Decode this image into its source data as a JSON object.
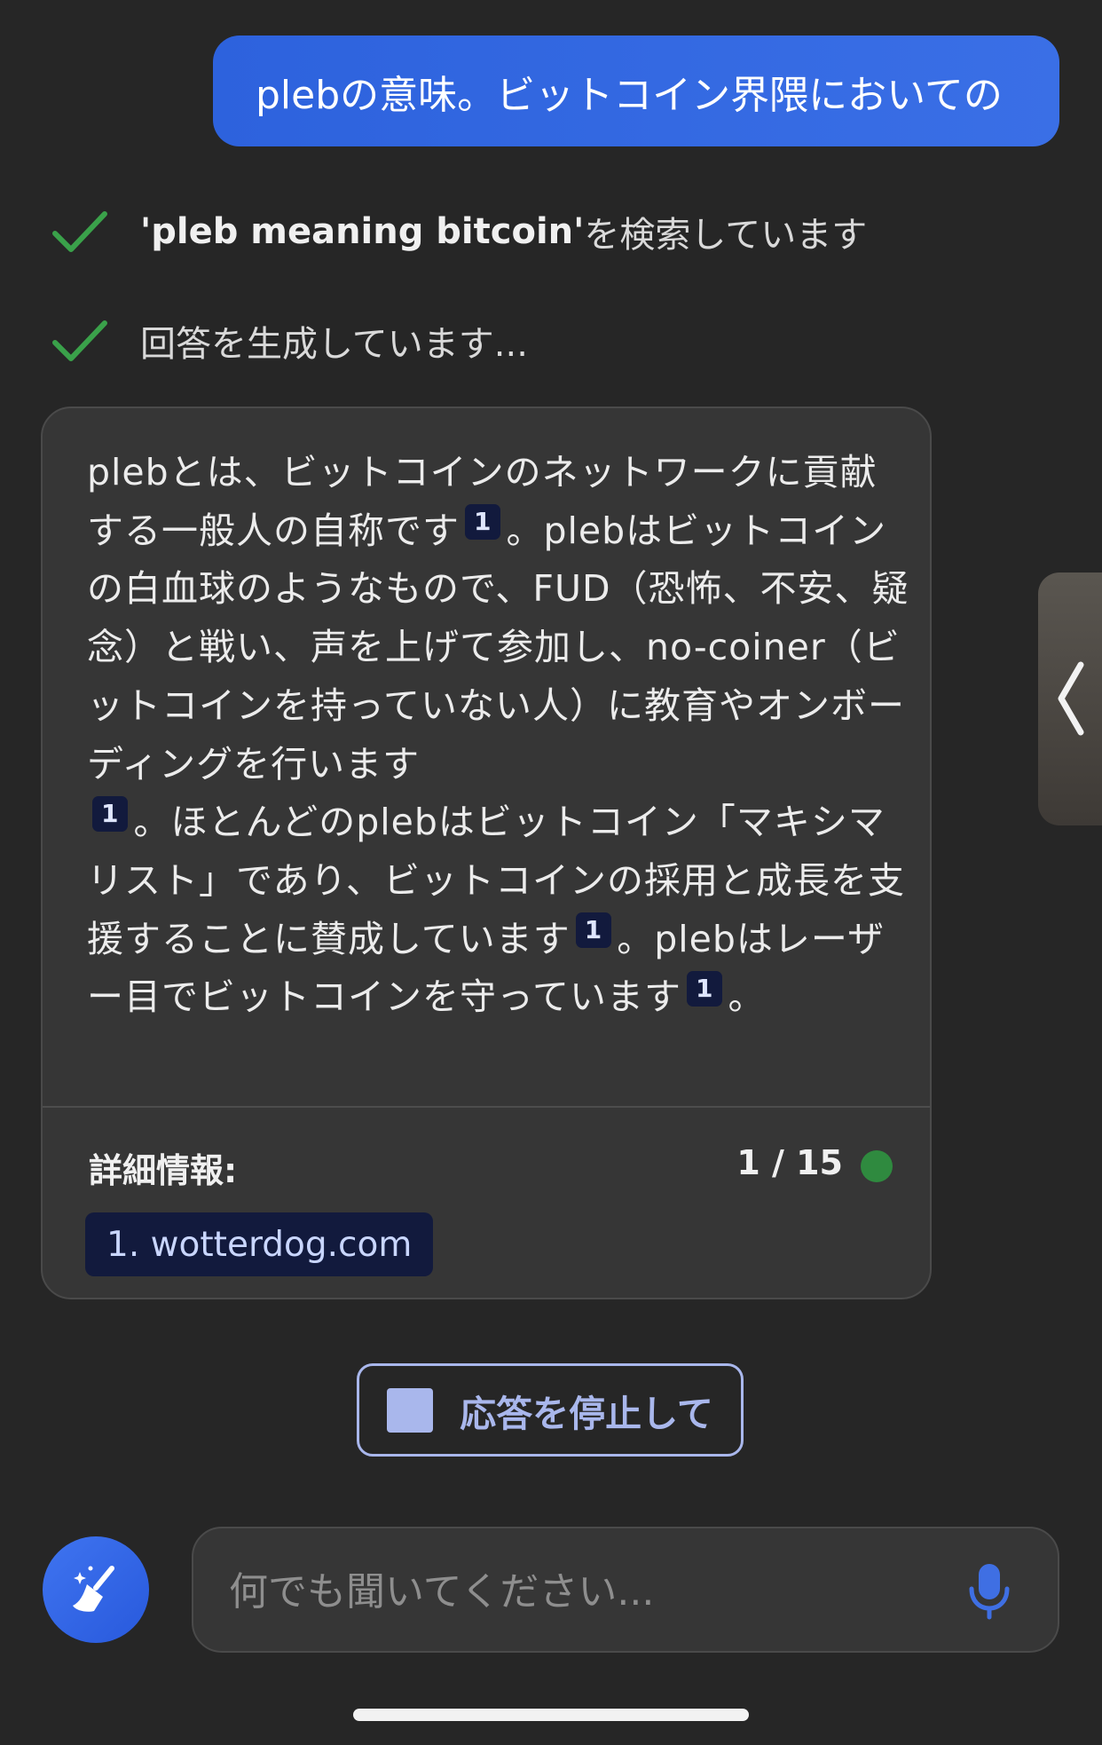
{
  "user_message": "plebの意味。ビットコイン界隈においての",
  "status": [
    {
      "query": "'pleb meaning bitcoin'",
      "text": " を検索しています"
    },
    {
      "query": "",
      "text": "回答を生成しています..."
    }
  ],
  "answer": {
    "segments": [
      "plebとは、ビットコインのネットワークに貢献する一般人の自称です",
      "。plebはビットコインの白血球のようなもので、FUD（恐怖、不安、疑念）と戦い、声を上げて参加し、no-coiner（ビットコインを持っていない人）に教育やオンボーディングを行います",
      "。ほとんどのplebはビットコイン「マキシマリスト」であり、ビットコインの採用と成長を支援することに賛成しています",
      "。plebはレーザー目でビットコインを守っています",
      "。"
    ],
    "citation_label": "1",
    "more_info_label": "詳細情報:",
    "page_count": "1 / 15",
    "source_chip": "1. wotterdog.com"
  },
  "stop_button_label": "応答を停止して",
  "input": {
    "placeholder": "何でも聞いてください..."
  },
  "colors": {
    "accent": "#2d62dd",
    "status_green": "#2f8a3f",
    "check_green": "#3aa14a",
    "citation_bg": "#121a3d"
  },
  "icons": {
    "check": "check-icon",
    "broom": "broom-icon",
    "mic": "microphone-icon",
    "handle": "chevron-left-icon",
    "stop": "stop-icon"
  }
}
